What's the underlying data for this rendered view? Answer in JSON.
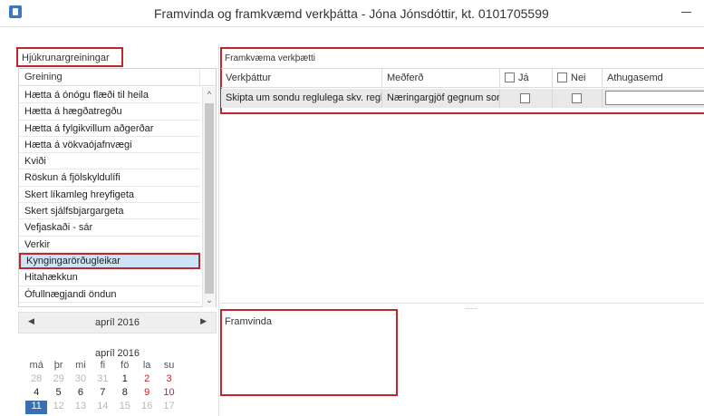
{
  "window": {
    "title": "Framvinda og framkvæmd verkþátta - Jóna Jónsdóttir, kt. 0101705599"
  },
  "left": {
    "header": "Hjúkrunargreiningar",
    "list_header": "Greining",
    "items": [
      "Hætta á ónógu flæði til heila",
      "Hætta á hægðatregðu",
      "Hætta á fylgikvillum aðgerðar",
      "Hætta á vökvaójafnvægi",
      "Kviði",
      "Röskun á fjölskyldulífi",
      "Skert líkamleg hreyfigeta",
      "Skert sjálfsbjargargeta",
      "Vefjaskaði - sár",
      "Verkir",
      "Kyngingarörðugleikar",
      "Hitahækkun",
      "Ófullnægjandi öndun"
    ],
    "selected_index": 10
  },
  "calendar": {
    "header_month": "apríl 2016",
    "title": "apríl 2016",
    "weekdays": [
      "má",
      "þr",
      "mi",
      "fi",
      "fö",
      "la",
      "su"
    ],
    "weeks": [
      [
        "28",
        "29",
        "30",
        "31",
        "1",
        "2",
        "3"
      ],
      [
        "4",
        "5",
        "6",
        "7",
        "8",
        "9",
        "10"
      ],
      [
        "11",
        "12",
        "13",
        "14",
        "15",
        "16",
        "17"
      ]
    ]
  },
  "verkthaettir": {
    "title": "Framkvæma verkþætti",
    "columns": [
      "Verkþáttur",
      "Meðferð",
      "Já",
      "Nei",
      "Athugasemd"
    ],
    "rows": [
      {
        "verkthattur": "Skipta um sondu reglulega skv. reglum",
        "medferd": "Næringargjöf gegnum sondu",
        "ja": false,
        "nei": false,
        "athugasemd": ""
      }
    ]
  },
  "framvinda": {
    "label": "Framvinda",
    "value": ""
  }
}
